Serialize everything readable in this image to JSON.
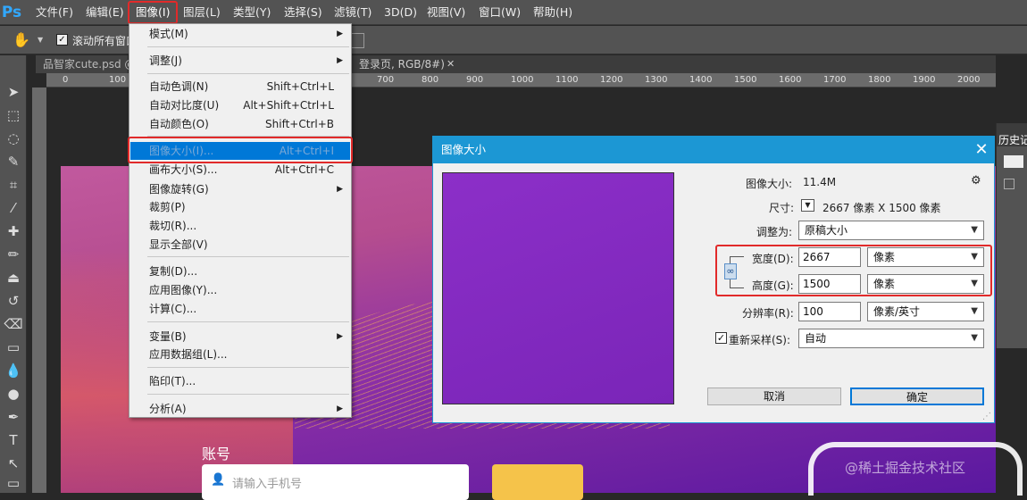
{
  "app": {
    "logo": "Ps"
  },
  "menubar": [
    "文件(F)",
    "编辑(E)",
    "图像(I)",
    "图层(L)",
    "类型(Y)",
    "选择(S)",
    "滤镜(T)",
    "3D(D)",
    "视图(V)",
    "窗口(W)",
    "帮助(H)"
  ],
  "options_bar": {
    "scroll_all_label": "滚动所有窗口"
  },
  "tabs": [
    "品智家cute.psd @",
    "登录页, RGB/8#)"
  ],
  "ruler_ticks": [
    "0",
    "100",
    "700",
    "800",
    "900",
    "1000",
    "1100",
    "1200",
    "1300",
    "1400",
    "1500",
    "1600",
    "1700",
    "1800",
    "1900",
    "2000"
  ],
  "dropdown": {
    "items": [
      {
        "label": "模式(M)",
        "shortcut": "",
        "submenu": true
      },
      {
        "label": "调整(J)",
        "shortcut": "",
        "submenu": true
      },
      {
        "label": "自动色调(N)",
        "shortcut": "Shift+Ctrl+L",
        "submenu": false
      },
      {
        "label": "自动对比度(U)",
        "shortcut": "Alt+Shift+Ctrl+L",
        "submenu": false
      },
      {
        "label": "自动颜色(O)",
        "shortcut": "Shift+Ctrl+B",
        "submenu": false
      },
      {
        "label": "图像大小(I)...",
        "shortcut": "Alt+Ctrl+I",
        "submenu": false
      },
      {
        "label": "画布大小(S)...",
        "shortcut": "Alt+Ctrl+C",
        "submenu": false
      },
      {
        "label": "图像旋转(G)",
        "shortcut": "",
        "submenu": true
      },
      {
        "label": "裁剪(P)",
        "shortcut": "",
        "submenu": false
      },
      {
        "label": "裁切(R)...",
        "shortcut": "",
        "submenu": false
      },
      {
        "label": "显示全部(V)",
        "shortcut": "",
        "submenu": false
      },
      {
        "label": "复制(D)...",
        "shortcut": "",
        "submenu": false
      },
      {
        "label": "应用图像(Y)...",
        "shortcut": "",
        "submenu": false
      },
      {
        "label": "计算(C)...",
        "shortcut": "",
        "submenu": false
      },
      {
        "label": "变量(B)",
        "shortcut": "",
        "submenu": true
      },
      {
        "label": "应用数据组(L)...",
        "shortcut": "",
        "submenu": false
      },
      {
        "label": "陷印(T)...",
        "shortcut": "",
        "submenu": false
      },
      {
        "label": "分析(A)",
        "shortcut": "",
        "submenu": true
      }
    ]
  },
  "dialog": {
    "title": "图像大小",
    "image_size_label": "图像大小:",
    "image_size_value": "11.4M",
    "dimensions_label": "尺寸:",
    "dimensions_value": "2667 像素  X  1500 像素",
    "fit_label": "调整为:",
    "fit_value": "原稿大小",
    "width_label": "宽度(D):",
    "width_value": "2667",
    "width_unit": "像素",
    "height_label": "高度(G):",
    "height_value": "1500",
    "height_unit": "像素",
    "resolution_label": "分辨率(R):",
    "resolution_value": "100",
    "resolution_unit": "像素/英寸",
    "resample_label": "重新采样(S):",
    "resample_value": "自动",
    "cancel": "取消",
    "ok": "确定"
  },
  "canvas": {
    "account_label": "账号",
    "phone_placeholder": "请输入手机号"
  },
  "panel": {
    "history_label": "历史记"
  },
  "watermark": "@稀土掘金技术社区",
  "colors": {
    "accent": "#1c97d4",
    "highlight": "#0078d7",
    "redbox": "#e12a2a"
  }
}
